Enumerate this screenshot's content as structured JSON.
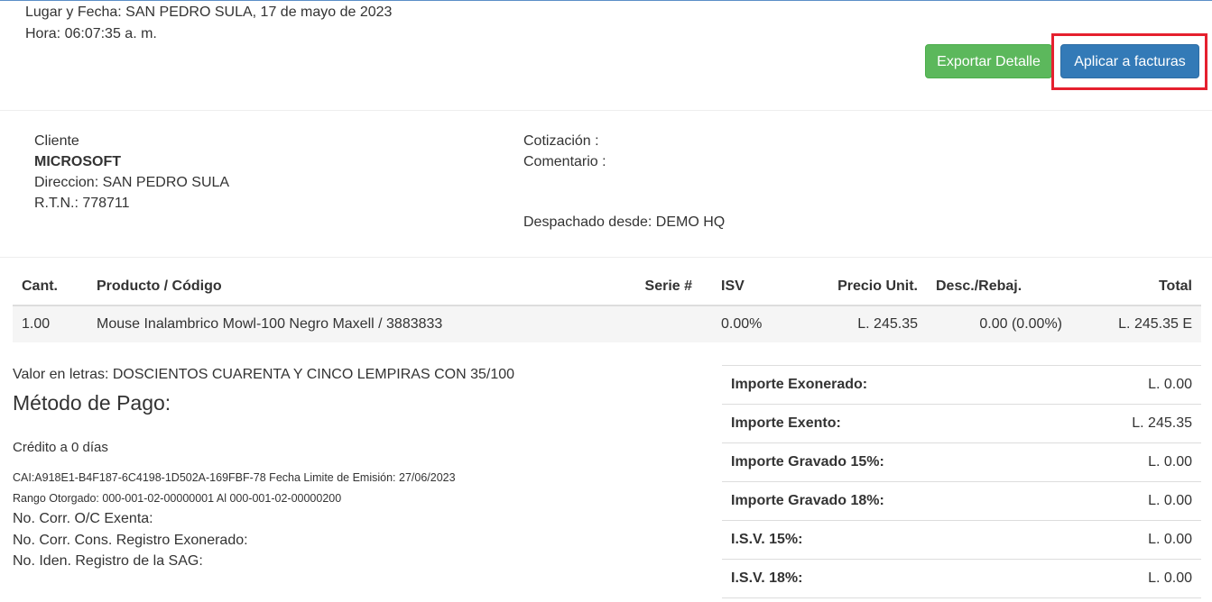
{
  "header": {
    "date_line": "Lugar y Fecha: SAN PEDRO SULA, 17 de mayo de 2023",
    "time_line": "Hora: 06:07:35 a. m.",
    "export_label": "Exportar Detalle",
    "apply_label": "Aplicar a facturas"
  },
  "client": {
    "label": "Cliente",
    "name": "MICROSOFT",
    "address": "Direccion: SAN PEDRO SULA",
    "rtn": "R.T.N.: 778711"
  },
  "quote": {
    "quote": "Cotización :",
    "comment": "Comentario :",
    "dispatch": "Despachado desde: DEMO HQ"
  },
  "items": {
    "headers": [
      "Cant.",
      "Producto / Código",
      "Serie #",
      "ISV",
      "Precio Unit.",
      "Desc./Rebaj.",
      "Total"
    ],
    "rows": [
      {
        "qty": "1.00",
        "product": "Mouse Inalambrico Mowl-100 Negro Maxell / 3883833",
        "serie": "",
        "isv": "0.00%",
        "price": "L. 245.35",
        "discount": "0.00 (0.00%)",
        "total": "L. 245.35 E"
      }
    ]
  },
  "footer": {
    "words": "Valor en letras: DOSCIENTOS CUARENTA Y CINCO LEMPIRAS CON 35/100",
    "payment_title": "Método de Pago:",
    "credit": "Crédito a 0 días",
    "cai": "CAI:A918E1-B4F187-6C4198-1D502A-169FBF-78 Fecha Limite de Emisión: 27/06/2023",
    "range": "Rango Otorgado: 000-001-02-00000001 Al 000-001-02-00000200",
    "corr1": "No. Corr. O/C Exenta:",
    "corr2": "No. Corr. Cons. Registro Exonerado:",
    "corr3": "No. Iden. Registro de la SAG:"
  },
  "totals": [
    {
      "label": "Importe Exonerado:",
      "value": "L. 0.00"
    },
    {
      "label": "Importe Exento:",
      "value": "L. 245.35"
    },
    {
      "label": "Importe Gravado 15%:",
      "value": "L. 0.00"
    },
    {
      "label": "Importe Gravado 18%:",
      "value": "L. 0.00"
    },
    {
      "label": "I.S.V. 15%:",
      "value": "L. 0.00"
    },
    {
      "label": "I.S.V. 18%:",
      "value": "L. 0.00"
    }
  ],
  "colors": {
    "export_button": "#5cb85c",
    "apply_button": "#337ab7",
    "highlight": "#e5202e"
  }
}
